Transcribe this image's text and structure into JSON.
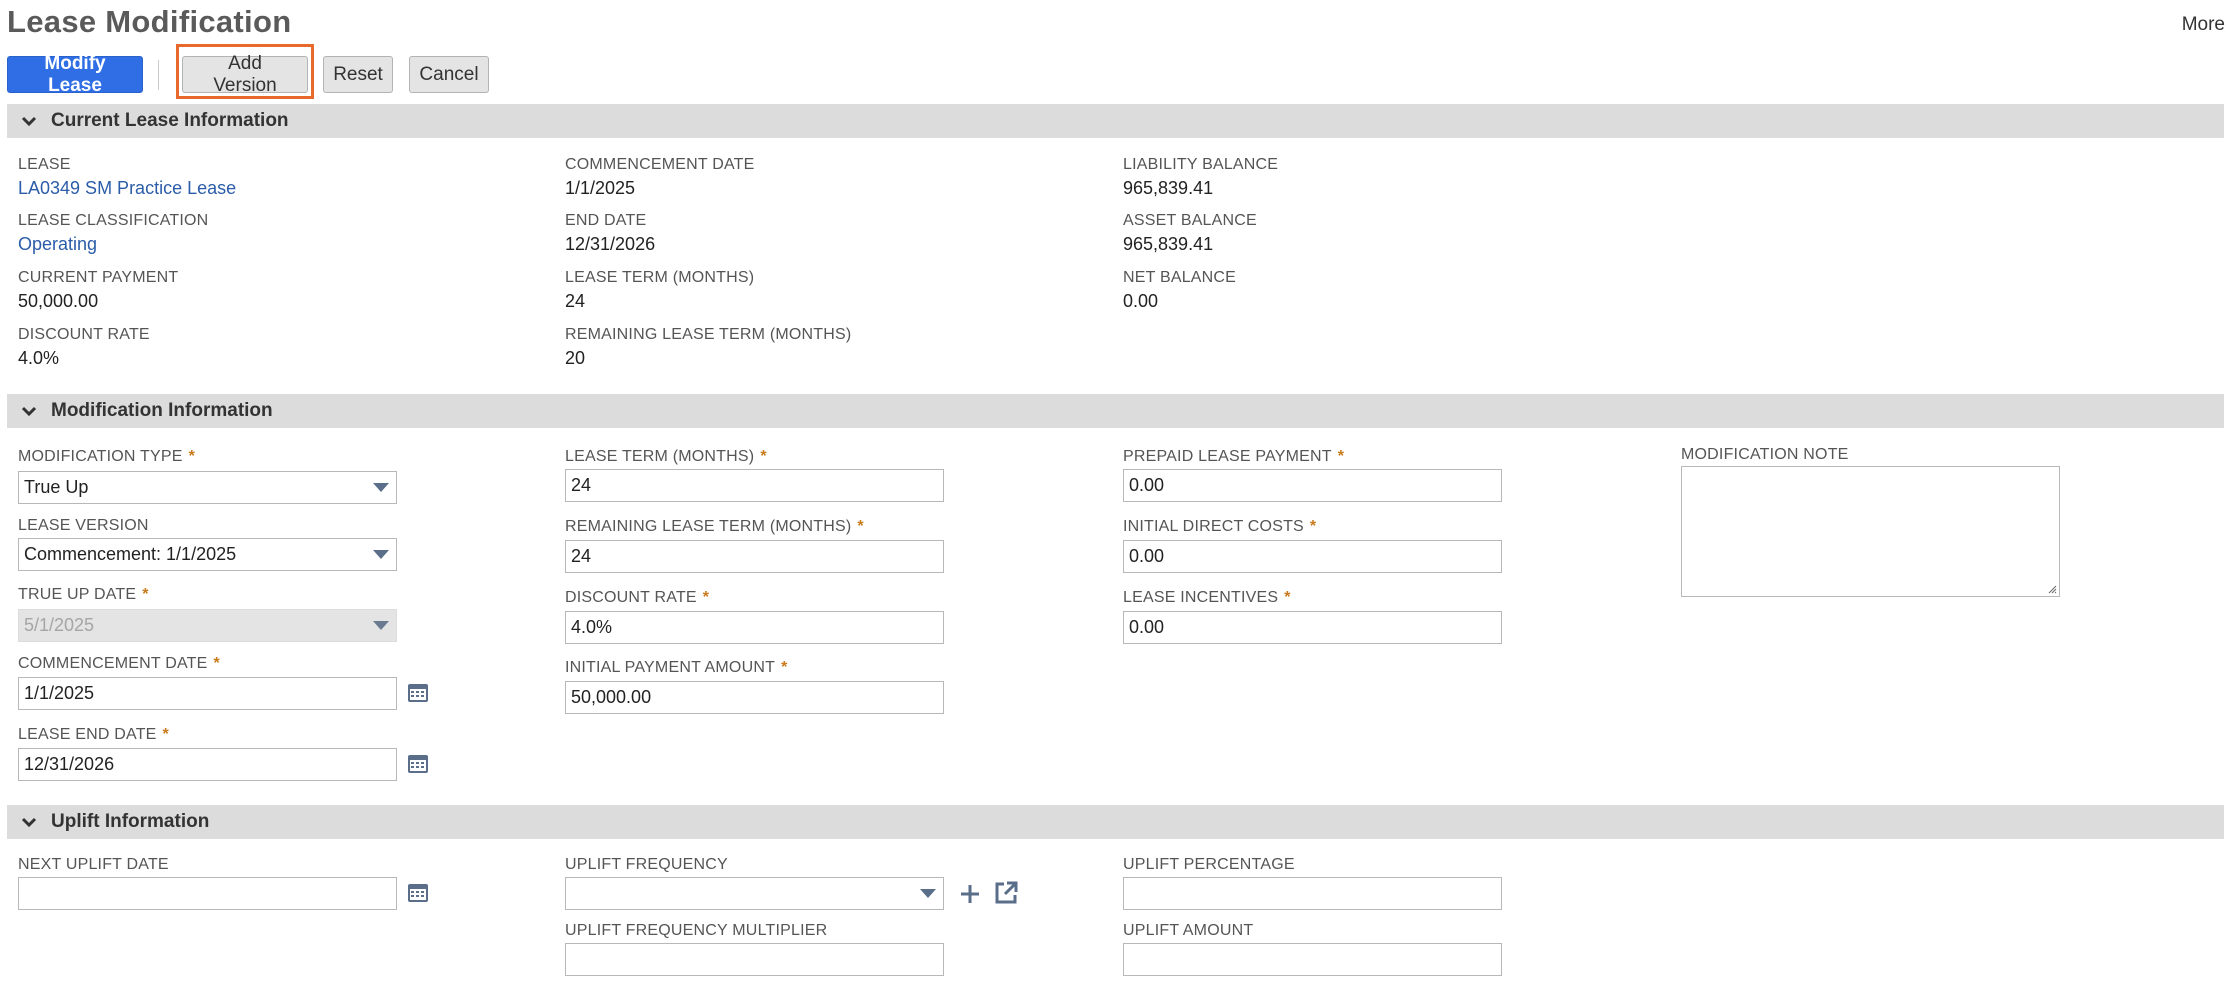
{
  "page": {
    "title": "Lease Modification",
    "more_label": "More"
  },
  "toolbar": {
    "modify_lease": "Modify Lease",
    "add_version": "Add Version",
    "reset": "Reset",
    "cancel": "Cancel"
  },
  "sections": {
    "current": "Current Lease Information",
    "modification": "Modification Information",
    "uplift": "Uplift Information"
  },
  "current_info": {
    "lease_label": "LEASE",
    "lease_value": "LA0349 SM Practice Lease",
    "classification_label": "LEASE CLASSIFICATION",
    "classification_value": "Operating",
    "current_payment_label": "CURRENT PAYMENT",
    "current_payment_value": "50,000.00",
    "discount_rate_label": "DISCOUNT RATE",
    "discount_rate_value": "4.0%",
    "commencement_label": "COMMENCEMENT DATE",
    "commencement_value": "1/1/2025",
    "end_date_label": "END DATE",
    "end_date_value": "12/31/2026",
    "lease_term_label": "LEASE TERM (MONTHS)",
    "lease_term_value": "24",
    "remaining_term_label": "REMAINING LEASE TERM (MONTHS)",
    "remaining_term_value": "20",
    "liability_label": "LIABILITY BALANCE",
    "liability_value": "965,839.41",
    "asset_label": "ASSET BALANCE",
    "asset_value": "965,839.41",
    "net_label": "NET BALANCE",
    "net_value": "0.00"
  },
  "modification": {
    "type_label": "MODIFICATION TYPE",
    "type_value": "True Up",
    "version_label": "LEASE VERSION",
    "version_value": "Commencement: 1/1/2025",
    "true_up_label": "TRUE UP DATE",
    "true_up_value": "5/1/2025",
    "commencement_label": "COMMENCEMENT DATE",
    "commencement_value": "1/1/2025",
    "end_label": "LEASE END DATE",
    "end_value": "12/31/2026",
    "term_label": "LEASE TERM (MONTHS)",
    "term_value": "24",
    "remaining_label": "REMAINING LEASE TERM (MONTHS)",
    "remaining_value": "24",
    "discount_label": "DISCOUNT RATE",
    "discount_value": "4.0%",
    "initial_payment_label": "INITIAL PAYMENT AMOUNT",
    "initial_payment_value": "50,000.00",
    "prepaid_label": "PREPAID LEASE PAYMENT",
    "prepaid_value": "0.00",
    "direct_costs_label": "INITIAL DIRECT COSTS",
    "direct_costs_value": "0.00",
    "incentives_label": "LEASE INCENTIVES",
    "incentives_value": "0.00",
    "note_label": "MODIFICATION NOTE",
    "required_mark": "*"
  },
  "uplift": {
    "next_date_label": "NEXT UPLIFT DATE",
    "frequency_label": "UPLIFT FREQUENCY",
    "multiplier_label": "UPLIFT FREQUENCY MULTIPLIER",
    "percentage_label": "UPLIFT PERCENTAGE",
    "amount_label": "UPLIFT AMOUNT"
  },
  "icons": {
    "chevron": "chevron-down-icon",
    "calendar": "calendar-icon",
    "plus": "plus-icon",
    "open": "open-external-icon"
  },
  "colors": {
    "primary_button": "#2f6ee4",
    "highlight": "#e8692c",
    "section_bg": "#dcdcdc",
    "link": "#2b5ca8",
    "required": "#c97a1a"
  }
}
